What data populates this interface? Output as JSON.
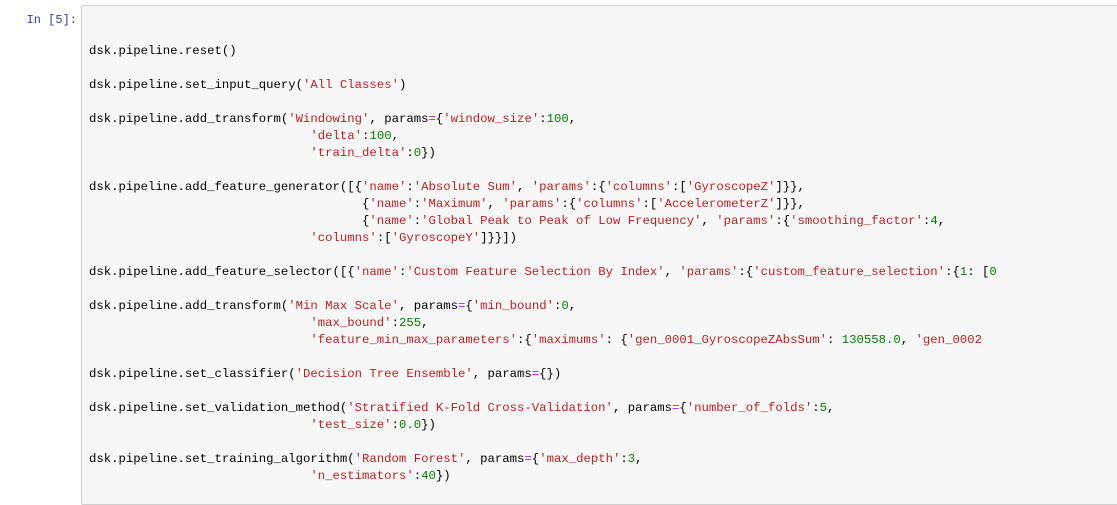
{
  "cell": {
    "prompt": "In [5]:"
  },
  "code_lines": [
    [
      {
        "t": "dsk.pipeline.reset()",
        "c": ""
      }
    ],
    [],
    [
      {
        "t": "dsk.pipeline.set_input_query(",
        "c": ""
      },
      {
        "t": "'All Classes'",
        "c": "s"
      },
      {
        "t": ")",
        "c": ""
      }
    ],
    [],
    [
      {
        "t": "dsk.pipeline.add_transform(",
        "c": ""
      },
      {
        "t": "'Windowing'",
        "c": "s"
      },
      {
        "t": ", params",
        "c": ""
      },
      {
        "t": "=",
        "c": "o"
      },
      {
        "t": "{",
        "c": ""
      },
      {
        "t": "'window_size'",
        "c": "s"
      },
      {
        "t": ":",
        "c": ""
      },
      {
        "t": "100",
        "c": "n"
      },
      {
        "t": ",",
        "c": ""
      }
    ],
    [
      {
        "t": "                              ",
        "c": ""
      },
      {
        "t": "'delta'",
        "c": "s"
      },
      {
        "t": ":",
        "c": ""
      },
      {
        "t": "100",
        "c": "n"
      },
      {
        "t": ",",
        "c": ""
      }
    ],
    [
      {
        "t": "                              ",
        "c": ""
      },
      {
        "t": "'train_delta'",
        "c": "s"
      },
      {
        "t": ":",
        "c": ""
      },
      {
        "t": "0",
        "c": "n"
      },
      {
        "t": "})",
        "c": ""
      }
    ],
    [],
    [
      {
        "t": "dsk.pipeline.add_feature_generator([{",
        "c": ""
      },
      {
        "t": "'name'",
        "c": "s"
      },
      {
        "t": ":",
        "c": ""
      },
      {
        "t": "'Absolute Sum'",
        "c": "s"
      },
      {
        "t": ", ",
        "c": ""
      },
      {
        "t": "'params'",
        "c": "s"
      },
      {
        "t": ":{",
        "c": ""
      },
      {
        "t": "'columns'",
        "c": "s"
      },
      {
        "t": ":[",
        "c": ""
      },
      {
        "t": "'GyroscopeZ'",
        "c": "s"
      },
      {
        "t": "]}},",
        "c": ""
      }
    ],
    [
      {
        "t": "                                     {",
        "c": ""
      },
      {
        "t": "'name'",
        "c": "s"
      },
      {
        "t": ":",
        "c": ""
      },
      {
        "t": "'Maximum'",
        "c": "s"
      },
      {
        "t": ", ",
        "c": ""
      },
      {
        "t": "'params'",
        "c": "s"
      },
      {
        "t": ":{",
        "c": ""
      },
      {
        "t": "'columns'",
        "c": "s"
      },
      {
        "t": ":[",
        "c": ""
      },
      {
        "t": "'AccelerometerZ'",
        "c": "s"
      },
      {
        "t": "]}},",
        "c": ""
      }
    ],
    [
      {
        "t": "                                     {",
        "c": ""
      },
      {
        "t": "'name'",
        "c": "s"
      },
      {
        "t": ":",
        "c": ""
      },
      {
        "t": "'Global Peak to Peak of Low Frequency'",
        "c": "s"
      },
      {
        "t": ", ",
        "c": ""
      },
      {
        "t": "'params'",
        "c": "s"
      },
      {
        "t": ":{",
        "c": ""
      },
      {
        "t": "'smoothing_factor'",
        "c": "s"
      },
      {
        "t": ":",
        "c": ""
      },
      {
        "t": "4",
        "c": "n"
      },
      {
        "t": ",",
        "c": ""
      }
    ],
    [
      {
        "t": "                              ",
        "c": ""
      },
      {
        "t": "'columns'",
        "c": "s"
      },
      {
        "t": ":[",
        "c": ""
      },
      {
        "t": "'GyroscopeY'",
        "c": "s"
      },
      {
        "t": "]}}])",
        "c": ""
      }
    ],
    [],
    [
      {
        "t": "dsk.pipeline.add_feature_selector([{",
        "c": ""
      },
      {
        "t": "'name'",
        "c": "s"
      },
      {
        "t": ":",
        "c": ""
      },
      {
        "t": "'Custom Feature Selection By Index'",
        "c": "s"
      },
      {
        "t": ", ",
        "c": ""
      },
      {
        "t": "'params'",
        "c": "s"
      },
      {
        "t": ":{",
        "c": ""
      },
      {
        "t": "'custom_feature_selection'",
        "c": "s"
      },
      {
        "t": ":{",
        "c": ""
      },
      {
        "t": "1",
        "c": "n"
      },
      {
        "t": ": [",
        "c": ""
      },
      {
        "t": "0",
        "c": "n"
      }
    ],
    [],
    [
      {
        "t": "dsk.pipeline.add_transform(",
        "c": ""
      },
      {
        "t": "'Min Max Scale'",
        "c": "s"
      },
      {
        "t": ", params",
        "c": ""
      },
      {
        "t": "=",
        "c": "o"
      },
      {
        "t": "{",
        "c": ""
      },
      {
        "t": "'min_bound'",
        "c": "s"
      },
      {
        "t": ":",
        "c": ""
      },
      {
        "t": "0",
        "c": "n"
      },
      {
        "t": ",",
        "c": ""
      }
    ],
    [
      {
        "t": "                              ",
        "c": ""
      },
      {
        "t": "'max_bound'",
        "c": "s"
      },
      {
        "t": ":",
        "c": ""
      },
      {
        "t": "255",
        "c": "n"
      },
      {
        "t": ",",
        "c": ""
      }
    ],
    [
      {
        "t": "                              ",
        "c": ""
      },
      {
        "t": "'feature_min_max_parameters'",
        "c": "s"
      },
      {
        "t": ":{",
        "c": ""
      },
      {
        "t": "'maximums'",
        "c": "s"
      },
      {
        "t": ": {",
        "c": ""
      },
      {
        "t": "'gen_0001_GyroscopeZAbsSum'",
        "c": "s"
      },
      {
        "t": ": ",
        "c": ""
      },
      {
        "t": "130558.0",
        "c": "n"
      },
      {
        "t": ", ",
        "c": ""
      },
      {
        "t": "'gen_0002",
        "c": "s"
      }
    ],
    [],
    [
      {
        "t": "dsk.pipeline.set_classifier(",
        "c": ""
      },
      {
        "t": "'Decision Tree Ensemble'",
        "c": "s"
      },
      {
        "t": ", params",
        "c": ""
      },
      {
        "t": "=",
        "c": "o"
      },
      {
        "t": "{})",
        "c": ""
      }
    ],
    [],
    [
      {
        "t": "dsk.pipeline.set_validation_method(",
        "c": ""
      },
      {
        "t": "'Stratified K-Fold Cross-Validation'",
        "c": "s"
      },
      {
        "t": ", params",
        "c": ""
      },
      {
        "t": "=",
        "c": "o"
      },
      {
        "t": "{",
        "c": ""
      },
      {
        "t": "'number_of_folds'",
        "c": "s"
      },
      {
        "t": ":",
        "c": ""
      },
      {
        "t": "5",
        "c": "n"
      },
      {
        "t": ",",
        "c": ""
      }
    ],
    [
      {
        "t": "                              ",
        "c": ""
      },
      {
        "t": "'test_size'",
        "c": "s"
      },
      {
        "t": ":",
        "c": ""
      },
      {
        "t": "0.0",
        "c": "n"
      },
      {
        "t": "})",
        "c": ""
      }
    ],
    [],
    [
      {
        "t": "dsk.pipeline.set_training_algorithm(",
        "c": ""
      },
      {
        "t": "'Random Forest'",
        "c": "s"
      },
      {
        "t": ", params",
        "c": ""
      },
      {
        "t": "=",
        "c": "o"
      },
      {
        "t": "{",
        "c": ""
      },
      {
        "t": "'max_depth'",
        "c": "s"
      },
      {
        "t": ":",
        "c": ""
      },
      {
        "t": "3",
        "c": "n"
      },
      {
        "t": ",",
        "c": ""
      }
    ],
    [
      {
        "t": "                              ",
        "c": ""
      },
      {
        "t": "'n_estimators'",
        "c": "s"
      },
      {
        "t": ":",
        "c": ""
      },
      {
        "t": "40",
        "c": "n"
      },
      {
        "t": "})",
        "c": ""
      }
    ]
  ]
}
